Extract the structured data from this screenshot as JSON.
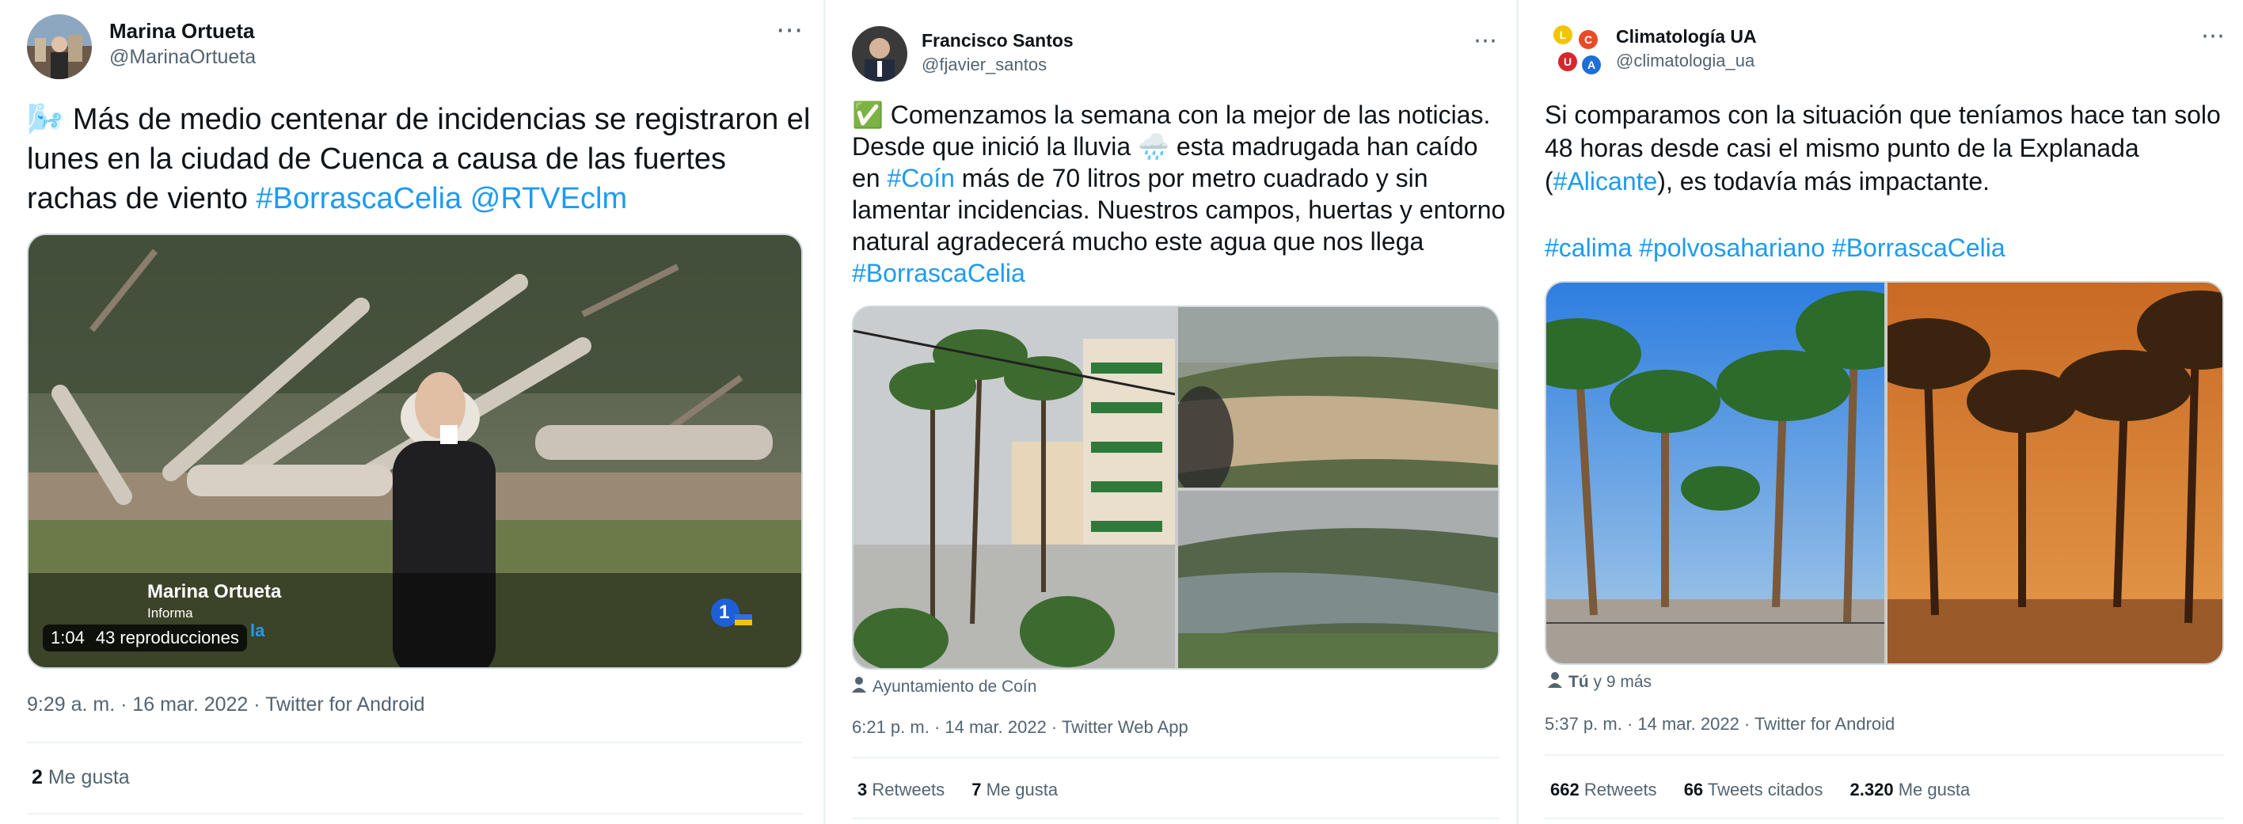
{
  "tweets": [
    {
      "name": "Marina Ortueta",
      "handle": "@MarinaOrtueta",
      "emoji": "🌬️",
      "text_main": " Más de medio centenar de incidencias se registraron el lunes en la ciudad de Cuenca a causa de las fuertes rachas de viento ",
      "tag1": "#BorrascaCelia",
      "tag2": "@RTVEclm",
      "video": {
        "lower_third_name": "Marina Ortueta",
        "lower_third_sub": "Informa",
        "lower_third_partial": "la",
        "duration": "1:04",
        "views": "43 reproducciones",
        "channel_logo": "1"
      },
      "meta": "9:29 a. m. · 16 mar. 2022 · Twitter for Android",
      "stats": [
        {
          "count": "2",
          "label": "Me gusta"
        }
      ]
    },
    {
      "name": "Francisco Santos",
      "handle": "@fjavier_santos",
      "check": "✅",
      "text_a": " Comenzamos la semana con la mejor de las noticias. Desde que inició la lluvia ",
      "rain": "🌧️",
      "text_b": " esta madrugada han caído en ",
      "tag1": "#Coín",
      "text_c": " más de 70 litros por metro cuadrado y sin lamentar incidencias. Nuestros campos, huertas y entorno natural agradecerá mucho este agua que nos llega ",
      "tag2": "#BorrascaCelia",
      "caption": "Ayuntamiento de Coín",
      "meta": "6:21 p. m. · 14 mar. 2022 · Twitter Web App",
      "stats": [
        {
          "count": "3",
          "label": "Retweets"
        },
        {
          "count": "7",
          "label": "Me gusta"
        }
      ]
    },
    {
      "name": "Climatología UA",
      "handle": "@climatologia_ua",
      "logo_letters": [
        "L",
        "U",
        "C",
        "A"
      ],
      "text_a": "Si comparamos con la situación que teníamos hace tan solo 48 horas desde casi el mismo punto de la Explanada (",
      "tag1": "#Alicante",
      "text_b": "), es todavía más impactante.",
      "tag2": "#calima",
      "tag3": "#polvosahariano",
      "tag4": "#BorrascaCelia",
      "caption_bold": "Tú",
      "caption_rest": " y 9 más",
      "meta": "5:37 p. m. · 14 mar. 2022 · Twitter for Android",
      "stats": [
        {
          "count": "662",
          "label": "Retweets"
        },
        {
          "count": "66",
          "label": "Tweets citados"
        },
        {
          "count": "2.320",
          "label": "Me gusta"
        }
      ]
    }
  ],
  "more_icon": "⋯",
  "colors": {
    "accent": "#1d9bf0",
    "muted": "#536471",
    "border": "#eff3f4"
  }
}
